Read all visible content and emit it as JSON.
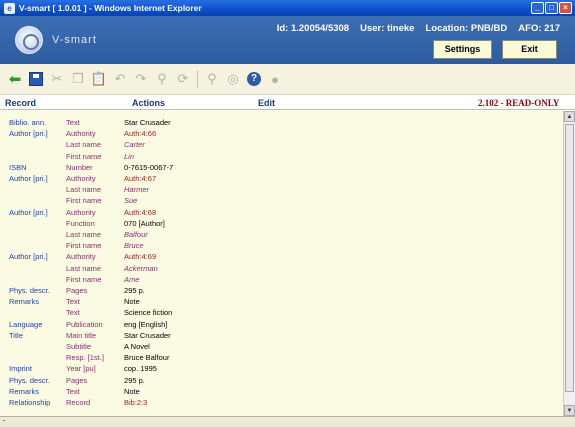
{
  "window": {
    "title": "V-smart [ 1.0.01 ] - Windows Internet Explorer",
    "icon_letter": "e"
  },
  "header": {
    "brand": "V-smart",
    "id_label": "Id: 1.20054/5308",
    "user_label": "User: tineke",
    "location_label": "Location: PNB/BD",
    "afo_label": "AFO: 217",
    "settings_label": "Settings",
    "exit_label": "Exit"
  },
  "toolbar": {
    "icons": [
      "back-arrow-icon",
      "save-icon",
      "cut-icon",
      "copy-icon",
      "paste-icon",
      "undo-icon",
      "redo-icon",
      "find-icon",
      "replace-icon",
      "search-authority-icon",
      "view-icon",
      "help-icon"
    ]
  },
  "menubar": {
    "record": "Record",
    "actions": "Actions",
    "edit": "Edit",
    "status": "2.102 - READ-ONLY"
  },
  "rows": [
    {
      "c1": "Biblio. ann.",
      "c2": "Text",
      "c3": "Star Crusader",
      "s": ""
    },
    {
      "c1": "Author [pri.]",
      "c2": "Authority",
      "c3": "Auth:4:66",
      "s": "link"
    },
    {
      "c1": "",
      "c2": "Last name",
      "c3": "Carter",
      "s": "ital"
    },
    {
      "c1": "",
      "c2": "First name",
      "c3": "Lin",
      "s": "ital"
    },
    {
      "c1": "ISBN",
      "c2": "Number",
      "c3": "0-7615-0067-7",
      "s": ""
    },
    {
      "c1": "Author [pri.]",
      "c2": "Authority",
      "c3": "Auth:4:67",
      "s": "link"
    },
    {
      "c1": "",
      "c2": "Last name",
      "c3": "Harmer",
      "s": "ital"
    },
    {
      "c1": "",
      "c2": "First name",
      "c3": "Sue",
      "s": "ital"
    },
    {
      "c1": "Author [pri.]",
      "c2": "Authority",
      "c3": "Auth:4:68",
      "s": "link"
    },
    {
      "c1": "",
      "c2": "Function",
      "c3": "070 [Author]",
      "s": ""
    },
    {
      "c1": "",
      "c2": "Last name",
      "c3": "Balfour",
      "s": "ital"
    },
    {
      "c1": "",
      "c2": "First name",
      "c3": "Bruce",
      "s": "ital"
    },
    {
      "c1": "Author [pri.]",
      "c2": "Authority",
      "c3": "Auth:4:69",
      "s": "link"
    },
    {
      "c1": "",
      "c2": "Last name",
      "c3": "Ackerman",
      "s": "ital"
    },
    {
      "c1": "",
      "c2": "First name",
      "c3": "Ame",
      "s": "ital"
    },
    {
      "c1": "Phys. descr.",
      "c2": "Pages",
      "c3": "295 p.",
      "s": ""
    },
    {
      "c1": "Remarks",
      "c2": "Text",
      "c3": "Note",
      "s": ""
    },
    {
      "c1": "",
      "c2": "Text",
      "c3": "Science fiction",
      "s": ""
    },
    {
      "c1": "Language",
      "c2": "Publication",
      "c3": "eng [English]",
      "s": ""
    },
    {
      "c1": "Title",
      "c2": "Main title",
      "c3": "Star Crusader",
      "s": ""
    },
    {
      "c1": "",
      "c2": "Subtitle",
      "c3": "A Novel",
      "s": ""
    },
    {
      "c1": "",
      "c2": "Resp. [1st.]",
      "c3": "Bruce Balfour",
      "s": ""
    },
    {
      "c1": "Imprint",
      "c2": "Year [pu]",
      "c3": "cop. 1995",
      "s": ""
    },
    {
      "c1": "Phys. descr.",
      "c2": "Pages",
      "c3": "295 p.",
      "s": ""
    },
    {
      "c1": "Remarks",
      "c2": "Text",
      "c3": "Note",
      "s": ""
    },
    {
      "c1": "Relationship",
      "c2": "Record",
      "c3": "Bib:2:3",
      "s": "link"
    }
  ],
  "statusbar": {
    "text": "-"
  }
}
